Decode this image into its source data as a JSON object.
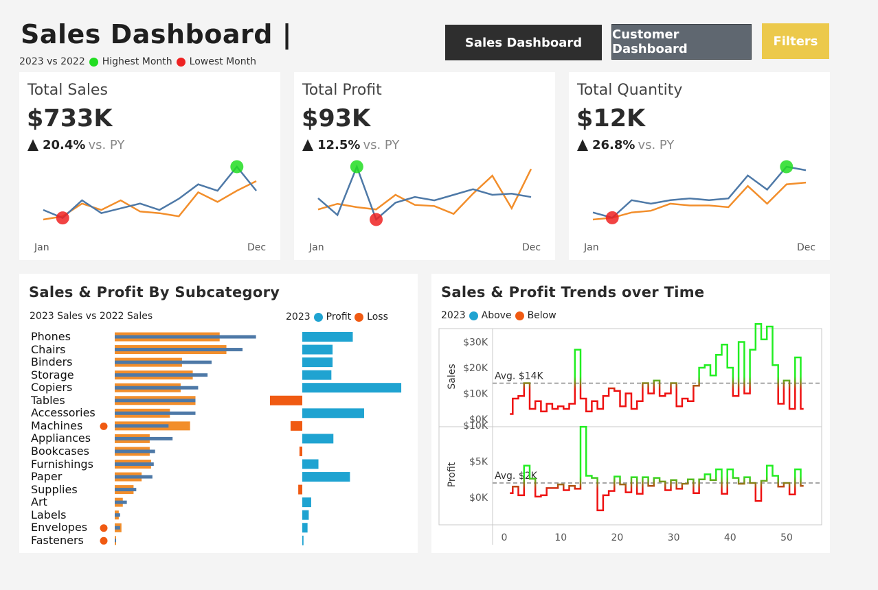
{
  "header": {
    "title": "Sales Dashboard |",
    "compare_label": "2023 vs 2022",
    "highest_label": "Highest Month",
    "lowest_label": "Lowest Month"
  },
  "nav": {
    "sales_label": "Sales Dashboard",
    "customer_label": "Customer Dashboard",
    "filters_label": "Filters"
  },
  "colors": {
    "current_year": "#4e79a7",
    "prior_year": "#f28e2b",
    "highest": "#22dd22",
    "lowest": "#ee2222",
    "profit": "#1fa3d1",
    "loss": "#f05a12",
    "above": "#22ee22",
    "below": "#ee1111",
    "nav_dark": "#2e2e2e",
    "nav_grey": "#5f6770",
    "nav_yellow": "#ecc94b"
  },
  "kpis": [
    {
      "title": "Total Sales",
      "value": "$733K",
      "change": "20.4%",
      "vs": "vs. PY",
      "start": "Jan",
      "end": "Dec",
      "cy": [
        8,
        3,
        14,
        6,
        9,
        12,
        8,
        15,
        24,
        20,
        35,
        20
      ],
      "py": [
        2,
        4,
        12,
        8,
        14,
        7,
        6,
        4,
        19,
        13,
        20,
        26
      ],
      "high_idx": 10,
      "low_idx": 1
    },
    {
      "title": "Total Profit",
      "value": "$93K",
      "change": "12.5%",
      "vs": "vs. PY",
      "start": "Jan",
      "end": "Dec",
      "cy": [
        12,
        -3,
        40,
        -7,
        8,
        13,
        10,
        15,
        20,
        15,
        16,
        13
      ],
      "py": [
        2,
        7,
        4,
        2,
        15,
        6,
        5,
        -2,
        16,
        32,
        3,
        38
      ],
      "high_idx": 2,
      "low_idx": 3
    },
    {
      "title": "Total Quantity",
      "value": "$12K",
      "change": "26.8%",
      "vs": "vs. PY",
      "start": "Jan",
      "end": "Dec",
      "cy": [
        5,
        2,
        12,
        10,
        12,
        13,
        12,
        13,
        26,
        18,
        31,
        29
      ],
      "py": [
        1,
        2,
        5,
        6,
        10,
        9,
        9,
        8,
        20,
        10,
        21,
        22
      ],
      "high_idx": 10,
      "low_idx": 1
    }
  ],
  "subcategory": {
    "title": "Sales & Profit By Subcategory",
    "sales_legend": "2023 Sales vs  2022 Sales",
    "profit_legend_year": "2023",
    "profit_label": "Profit",
    "loss_label": "Loss"
  },
  "trends": {
    "title": "Sales & Profit Trends over Time",
    "legend_year": "2023",
    "above_label": "Above",
    "below_label": "Below"
  },
  "chart_data": [
    {
      "type": "bar",
      "title": "Sales & Profit By Subcategory",
      "categories": [
        "Phones",
        "Chairs",
        "Binders",
        "Storage",
        "Copiers",
        "Tables",
        "Accessories",
        "Machines",
        "Appliances",
        "Bookcases",
        "Furnishings",
        "Paper",
        "Supplies",
        "Art",
        "Labels",
        "Envelopes",
        "Fasteners"
      ],
      "series": [
        {
          "name": "2023 Sales",
          "values": [
            105,
            95,
            72,
            69,
            62,
            60,
            60,
            40,
            43,
            30,
            29,
            28,
            16,
            9,
            4,
            4,
            1
          ]
        },
        {
          "name": "2022 Sales",
          "values": [
            78,
            83,
            50,
            58,
            49,
            60,
            41,
            56,
            26,
            26,
            27,
            20,
            14,
            6,
            3,
            5,
            1
          ]
        },
        {
          "name": "Profit",
          "values": [
            12.5,
            7.5,
            7.5,
            7.2,
            24.5,
            -8.0,
            15.3,
            -2.9,
            7.7,
            -0.7,
            4.0,
            11.8,
            -1.0,
            2.2,
            1.6,
            1.3,
            0.3
          ]
        }
      ],
      "marked_categories": [
        "Machines",
        "Envelopes",
        "Fasteners"
      ]
    },
    {
      "type": "line",
      "title": "Sales & Profit Trends over Time",
      "x": [
        1,
        2,
        3,
        4,
        5,
        6,
        7,
        8,
        9,
        10,
        11,
        12,
        13,
        14,
        15,
        16,
        17,
        18,
        19,
        20,
        21,
        22,
        23,
        24,
        25,
        26,
        27,
        28,
        29,
        30,
        31,
        32,
        33,
        34,
        35,
        36,
        37,
        38,
        39,
        40,
        41,
        42,
        43,
        44,
        45,
        46,
        47,
        48,
        49,
        50,
        51,
        52,
        53
      ],
      "ylabel_top": "Sales",
      "ylabel_bottom": "Profit",
      "y_ticks_sales": [
        "$0K",
        "$10K",
        "$20K",
        "$30K"
      ],
      "y_ticks_profit": [
        "$0K",
        "$5K",
        "$10K"
      ],
      "x_ticks": [
        "0",
        "10",
        "20",
        "30",
        "40",
        "50"
      ],
      "series": [
        {
          "name": "Sales",
          "avg_label": "Avg. $14K",
          "avg": 14,
          "values": [
            2,
            8,
            9,
            14,
            4,
            7,
            3,
            6,
            4,
            5,
            4,
            6,
            27,
            8,
            3,
            7,
            4,
            9,
            12,
            11,
            5,
            10,
            4,
            7,
            14,
            10,
            15,
            9,
            10,
            14,
            5,
            8,
            7,
            13,
            20,
            21,
            17,
            25,
            29,
            20,
            9,
            30,
            10,
            27,
            37,
            31,
            36,
            21,
            6,
            15,
            4,
            24,
            4
          ]
        },
        {
          "name": "Profit",
          "avg_label": "Avg. $2K",
          "avg": 2,
          "values": [
            0.6,
            1.5,
            0.3,
            4.4,
            2.6,
            0.1,
            0.3,
            1.3,
            1.3,
            1.8,
            1.0,
            1.6,
            1.2,
            9.8,
            3.0,
            2.7,
            -1.8,
            0.3,
            0.9,
            2.9,
            1.8,
            0.7,
            2.8,
            0.5,
            2.8,
            1.6,
            2.7,
            2.2,
            1.0,
            2.4,
            1.2,
            1.9,
            2.5,
            0.6,
            2.5,
            3.2,
            2.4,
            3.9,
            0.5,
            3.9,
            2.7,
            1.9,
            2.8,
            2.0,
            -0.5,
            2.3,
            4.4,
            3.0,
            1.5,
            2.0,
            0.4,
            3.9,
            1.6
          ]
        }
      ]
    }
  ]
}
